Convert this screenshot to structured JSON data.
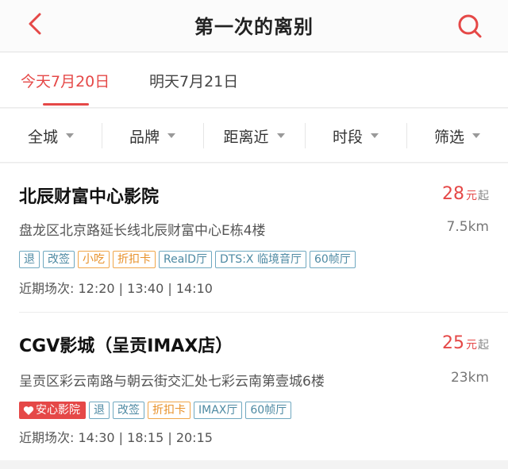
{
  "header": {
    "title": "第一次的离别"
  },
  "date_tabs": [
    {
      "label": "今天7月20日",
      "active": true
    },
    {
      "label": "明天7月21日",
      "active": false
    }
  ],
  "filters": [
    "全城",
    "品牌",
    "距离近",
    "时段",
    "筛选"
  ],
  "cinemas": [
    {
      "name": "北辰财富中心影院",
      "price": "28",
      "price_unit": "元",
      "price_suffix": "起",
      "address": "盘龙区北京路延长线北辰财富中心E栋4楼",
      "distance": "7.5km",
      "tags": [
        {
          "text": "退",
          "style": "blue"
        },
        {
          "text": "改签",
          "style": "blue"
        },
        {
          "text": "小吃",
          "style": "orange"
        },
        {
          "text": "折扣卡",
          "style": "orange"
        },
        {
          "text": "RealD厅",
          "style": "blue"
        },
        {
          "text": "DTS:X 临境音厅",
          "style": "blue"
        },
        {
          "text": "60帧厅",
          "style": "blue"
        }
      ],
      "showtimes": "近期场次: 12:20 | 13:40 | 14:10"
    },
    {
      "name": "CGV影城（呈贡IMAX店）",
      "price": "25",
      "price_unit": "元",
      "price_suffix": "起",
      "address": "呈贡区彩云南路与朝云街交汇处七彩云南第壹城6楼",
      "distance": "23km",
      "tags": [
        {
          "text": "安心影院",
          "style": "badge"
        },
        {
          "text": "退",
          "style": "blue"
        },
        {
          "text": "改签",
          "style": "blue"
        },
        {
          "text": "折扣卡",
          "style": "orange"
        },
        {
          "text": "IMAX厅",
          "style": "blue"
        },
        {
          "text": "60帧厅",
          "style": "blue"
        }
      ],
      "showtimes": "近期场次: 14:30 | 18:15 | 20:15"
    }
  ],
  "colors": {
    "accent": "#e54847",
    "tag_blue": "#4e8aa3",
    "tag_orange": "#e8912a"
  },
  "icons": {
    "back": "chevron-left-icon",
    "search": "search-icon",
    "badge": "heart-icon"
  }
}
